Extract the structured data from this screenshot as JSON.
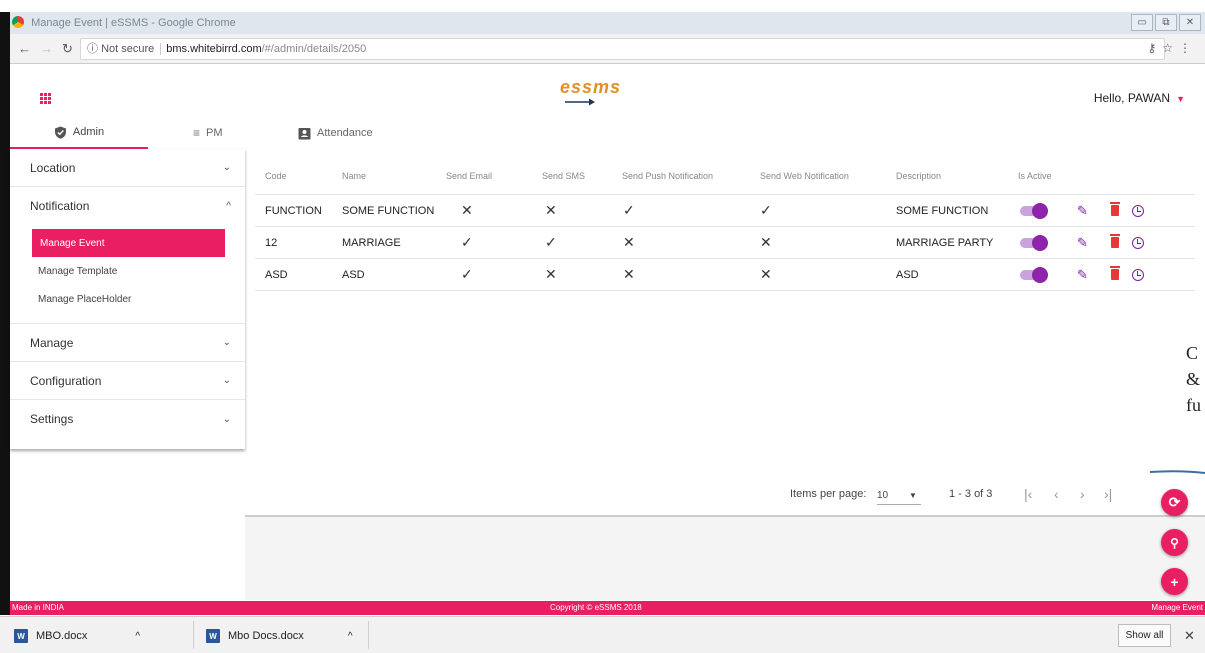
{
  "browser": {
    "window_title": "Manage Event | eSSMS - Google Chrome",
    "not_secure": "Not secure",
    "url_host": "bms.whitebirrd.com",
    "url_path": "/#/admin/details/2050"
  },
  "header": {
    "logo": "essms",
    "greeting": "Hello, PAWAN"
  },
  "tabs": [
    {
      "label": "Admin",
      "icon": "shield-check-icon",
      "active": true
    },
    {
      "label": "PM",
      "icon": "menu-lines-icon",
      "active": false
    },
    {
      "label": "Attendance",
      "icon": "contact-card-icon",
      "active": false
    }
  ],
  "sidebar": {
    "sections": [
      {
        "label": "Location",
        "expanded": false
      },
      {
        "label": "Notification",
        "expanded": true
      },
      {
        "label": "Manage",
        "expanded": false
      },
      {
        "label": "Configuration",
        "expanded": false
      },
      {
        "label": "Settings",
        "expanded": false
      }
    ],
    "notification_items": [
      {
        "label": "Manage Event",
        "active": true
      },
      {
        "label": "Manage Template",
        "active": false
      },
      {
        "label": "Manage PlaceHolder",
        "active": false
      }
    ]
  },
  "table": {
    "columns": [
      "Code",
      "Name",
      "Send Email",
      "Send SMS",
      "Send Push Notification",
      "Send Web Notification",
      "Description",
      "Is Active"
    ],
    "rows": [
      {
        "code": "FUNCTION",
        "name": "SOME FUNCTION",
        "email": "✕",
        "sms": "✕",
        "push": "✓",
        "web": "✓",
        "description": "SOME FUNCTION",
        "active": true
      },
      {
        "code": "12",
        "name": "MARRIAGE",
        "email": "✓",
        "sms": "✓",
        "push": "✕",
        "web": "✕",
        "description": "MARRIAGE PARTY",
        "active": true
      },
      {
        "code": "ASD",
        "name": "ASD",
        "email": "✓",
        "sms": "✕",
        "push": "✕",
        "web": "✕",
        "description": "ASD",
        "active": true
      }
    ]
  },
  "overlay_text": [
    "C",
    "&",
    "fu"
  ],
  "paginator": {
    "items_per_page_label": "Items per page:",
    "items_per_page": "10",
    "range": "1 - 3 of 3"
  },
  "footer": {
    "left": "Made in INDIA",
    "center": "Copyright © eSSMS 2018",
    "right": "Manage Event"
  },
  "downloads": {
    "items": [
      "MBO.docx",
      "Mbo Docs.docx"
    ],
    "show_all": "Show all"
  },
  "colors": {
    "accent": "#e91e63",
    "purple": "#8e24aa",
    "logo": "#e4902a"
  }
}
